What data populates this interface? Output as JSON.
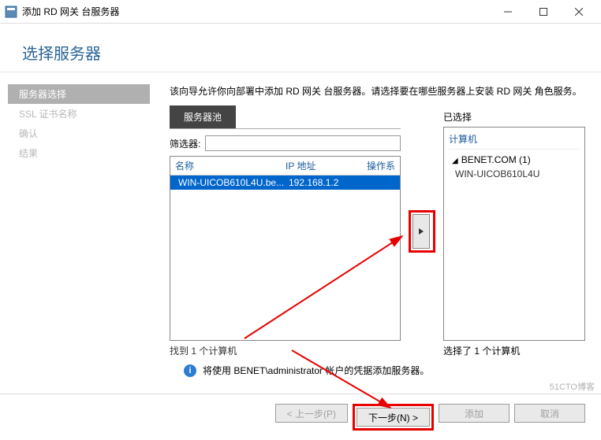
{
  "titlebar": {
    "text": "添加 RD 网关 台服务器"
  },
  "header": {
    "title": "选择服务器"
  },
  "sidebar": {
    "items": [
      {
        "label": "服务器选择",
        "active": true
      },
      {
        "label": "SSL 证书名称",
        "active": false
      },
      {
        "label": "确认",
        "active": false
      },
      {
        "label": "结果",
        "active": false
      }
    ]
  },
  "content": {
    "description": "该向导允许你向部署中添加 RD 网关 台服务器。请选择要在哪些服务器上安装 RD 网关 角色服务。",
    "pool_tab": "服务器池",
    "filter_label": "筛选器:",
    "filter_value": "",
    "table": {
      "headers": {
        "name": "名称",
        "ip": "IP 地址",
        "os": "操作系"
      },
      "rows": [
        {
          "name": "WIN-UICOB610L4U.be...",
          "ip": "192.168.1.2",
          "selected": true
        }
      ]
    },
    "found_text": "找到 1 个计算机",
    "selected_label": "已选择",
    "computer_header": "计算机",
    "domain": "BENET.COM (1)",
    "selected_server": "WIN-UICOB610L4U",
    "selected_count_text": "选择了 1 个计算机",
    "info_text": "将使用 BENET\\administrator 帐户的凭据添加服务器。"
  },
  "footer": {
    "prev": "< 上一步(P)",
    "next": "下一步(N) >",
    "add": "添加",
    "cancel": "取消"
  },
  "watermark": "51CTO博客"
}
